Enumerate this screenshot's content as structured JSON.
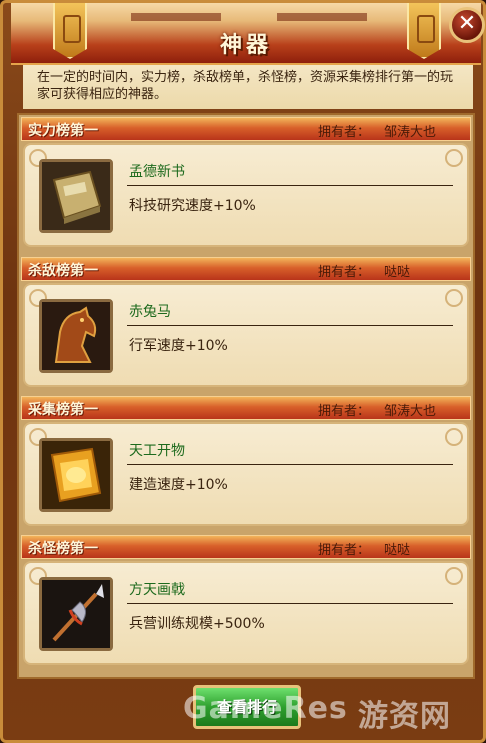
{
  "window": {
    "title": "神器",
    "close_label": "✕"
  },
  "intro": "在一定的时间内，实力榜，杀敌榜单，杀怪榜，资源采集榜排行第一的玩家可获得相应的神器。",
  "owner_label": "拥有者：",
  "sections": [
    {
      "name": "实力榜第一",
      "owner": "邹涛大也",
      "item": {
        "name": "孟德新书",
        "desc": "科技研究速度+10%",
        "icon": "book-icon"
      }
    },
    {
      "name": "杀敌榜第一",
      "owner": "哒哒",
      "item": {
        "name": "赤兔马",
        "desc": "行军速度+10%",
        "icon": "horse-icon"
      }
    },
    {
      "name": "采集榜第一",
      "owner": "邹涛大也",
      "item": {
        "name": "天工开物",
        "desc": "建造速度+10%",
        "icon": "scroll-icon"
      }
    },
    {
      "name": "杀怪榜第一",
      "owner": "哒哒",
      "item": {
        "name": "方天画戟",
        "desc": "兵营训练规模+500%",
        "icon": "halberd-icon"
      }
    }
  ],
  "footer": {
    "button_label": "查看排行"
  },
  "watermark": {
    "latin": "GameRes",
    "cn": "游资网"
  }
}
